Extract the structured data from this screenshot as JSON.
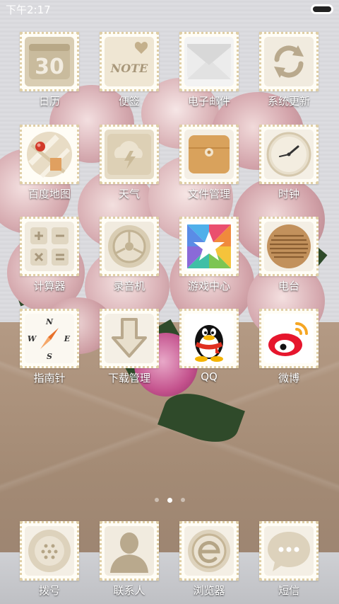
{
  "status_bar": {
    "time": "下午2:17"
  },
  "apps": [
    {
      "label": "日历",
      "icon": "calendar-icon",
      "date_number": "30"
    },
    {
      "label": "便签",
      "icon": "note-icon",
      "icon_text": "NOTE"
    },
    {
      "label": "电子邮件",
      "icon": "mail-icon"
    },
    {
      "label": "系统更新",
      "icon": "update-icon"
    },
    {
      "label": "百度地图",
      "icon": "map-icon"
    },
    {
      "label": "天气",
      "icon": "weather-icon"
    },
    {
      "label": "文件管理",
      "icon": "folder-icon"
    },
    {
      "label": "时钟",
      "icon": "clock-icon"
    },
    {
      "label": "计算器",
      "icon": "calculator-icon"
    },
    {
      "label": "录音机",
      "icon": "recorder-icon"
    },
    {
      "label": "游戏中心",
      "icon": "game-center-icon"
    },
    {
      "label": "电台",
      "icon": "radio-icon"
    },
    {
      "label": "指南针",
      "icon": "compass-icon",
      "compass_letters": [
        "N",
        "W",
        "E",
        "S"
      ]
    },
    {
      "label": "下载管理",
      "icon": "download-icon"
    },
    {
      "label": "QQ",
      "icon": "qq-icon"
    },
    {
      "label": "微博",
      "icon": "weibo-icon"
    }
  ],
  "page_indicator": {
    "pages": 3,
    "current": 2
  },
  "dock": [
    {
      "label": "拨号",
      "icon": "phone-icon"
    },
    {
      "label": "联系人",
      "icon": "contacts-icon"
    },
    {
      "label": "浏览器",
      "icon": "browser-icon"
    },
    {
      "label": "短信",
      "icon": "messages-icon"
    }
  ],
  "colors": {
    "stamp_border": "#e0cfa6",
    "icon_beige": "#d9cdb3",
    "label_text": "#ffffff"
  }
}
